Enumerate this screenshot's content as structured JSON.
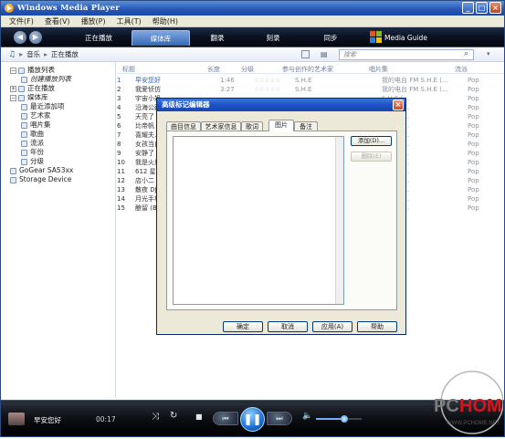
{
  "window": {
    "title": "Windows Media Player",
    "minimize": "_",
    "maximize": "□",
    "close": "×"
  },
  "menu": [
    "文件(F)",
    "查看(V)",
    "播放(P)",
    "工具(T)",
    "帮助(H)"
  ],
  "nav": {
    "back": "◀",
    "forward": "▶",
    "tabs": [
      "正在播放",
      "媒体库",
      "翻录",
      "刻录",
      "同步",
      "Media Guide"
    ],
    "active_tab": "媒体库"
  },
  "address": {
    "crumb1": "音乐",
    "sep": "▸",
    "crumb2": "正在播放",
    "search_placeholder": "搜索"
  },
  "sidebar": {
    "items": [
      {
        "label": "播放列表",
        "level": 0,
        "expand": "−"
      },
      {
        "label": "创建播放列表",
        "level": 1
      },
      {
        "label": "正在播放",
        "level": 0,
        "expand": "+"
      },
      {
        "label": "媒体库",
        "level": 0,
        "expand": "−"
      },
      {
        "label": "最近添加项",
        "level": 1
      },
      {
        "label": "艺术家",
        "level": 1
      },
      {
        "label": "唱片集",
        "level": 1
      },
      {
        "label": "歌曲",
        "level": 1
      },
      {
        "label": "流派",
        "level": 1
      },
      {
        "label": "年份",
        "level": 1
      },
      {
        "label": "分级",
        "level": 1
      },
      {
        "label": "GoGear SA53xx",
        "level": 0
      },
      {
        "label": "Storage Device",
        "level": 0
      }
    ]
  },
  "list": {
    "headers": {
      "title": "标题",
      "length": "长度",
      "rating": "分级",
      "artist": "参与创作的艺术家",
      "album": "唱片集",
      "genre": "流派"
    },
    "rows": [
      {
        "n": "1",
        "title": "早安您好",
        "length": "1:46",
        "rating": "☆☆☆☆☆",
        "artist": "S.H.E",
        "album": "我的电台 FM S.H.E (...",
        "genre": "Pop"
      },
      {
        "n": "2",
        "title": "我爱侦仿",
        "length": "3:27",
        "rating": "☆☆☆☆☆",
        "artist": "S.H.E",
        "album": "我的电台 FM S.H.E (...",
        "genre": "Pop"
      },
      {
        "n": "3",
        "title": "宇宙小姐",
        "length": "",
        "rating": "",
        "artist": "",
        "album": "S.H.E (...",
        "genre": "Pop"
      },
      {
        "n": "4",
        "title": "沿海公路的...",
        "length": "",
        "rating": "",
        "artist": "",
        "album": "S.H.E (...",
        "genre": "Pop"
      },
      {
        "n": "5",
        "title": "天亮了",
        "length": "",
        "rating": "",
        "artist": "",
        "album": "S.H.E (...",
        "genre": "Pop"
      },
      {
        "n": "6",
        "title": "比帝帆 (f...",
        "length": "",
        "rating": "",
        "artist": "",
        "album": "S.H.E (...",
        "genre": "Pop"
      },
      {
        "n": "7",
        "title": "喜耀夫人时...",
        "length": "",
        "rating": "",
        "artist": "",
        "album": "S.H.E (...",
        "genre": "Pop"
      },
      {
        "n": "8",
        "title": "女孩当自强...",
        "length": "",
        "rating": "",
        "artist": "",
        "album": "S.H.E (...",
        "genre": "Pop"
      },
      {
        "n": "9",
        "title": "安静了",
        "length": "",
        "rating": "",
        "artist": "",
        "album": "S.H.E (...",
        "genre": "Pop"
      },
      {
        "n": "10",
        "title": "我是火星人...",
        "length": "",
        "rating": "",
        "artist": "",
        "album": "S.H.E (...",
        "genre": "Pop"
      },
      {
        "n": "11",
        "title": "612 星球",
        "length": "",
        "rating": "",
        "artist": "",
        "album": "S.H.E (...",
        "genre": "Pop"
      },
      {
        "n": "12",
        "title": "店小二",
        "length": "",
        "rating": "",
        "artist": "",
        "album": "S.H.E (...",
        "genre": "Pop"
      },
      {
        "n": "13",
        "title": "散夜 DJ",
        "length": "",
        "rating": "",
        "artist": "",
        "album": "S.H.E (...",
        "genre": "Pop"
      },
      {
        "n": "14",
        "title": "月光手札",
        "length": "",
        "rating": "",
        "artist": "",
        "album": "S.H.E (...",
        "genre": "Pop"
      },
      {
        "n": "15",
        "title": "酿留 (Bonu...",
        "length": "",
        "rating": "",
        "artist": "",
        "album": "S.H.E (...",
        "genre": "Pop"
      }
    ]
  },
  "player": {
    "now_playing": "早安您好",
    "time": "00:17",
    "shuffle": "⤨",
    "repeat": "↻",
    "stop": "■",
    "prev": "⏮",
    "play": "❚❚",
    "next": "⏭",
    "volume_icon": "🔈",
    "volume_level": 0.62
  },
  "dialog": {
    "title": "高级标记编辑器",
    "close": "×",
    "tabs": [
      "曲目信息",
      "艺术家信息",
      "歌词",
      "图片",
      "备注"
    ],
    "active_tab": "图片",
    "add_button": "添加(D)...",
    "delete_button": "删除(E)",
    "ok": "确定",
    "cancel": "取消",
    "apply": "应用(A)",
    "help": "帮助"
  },
  "watermark": {
    "brand": "PCHOME",
    "sub": "WWW.PCHOME.NET",
    "colors": {
      "red": "#d8151a",
      "gray": "#7a7a7a"
    }
  }
}
